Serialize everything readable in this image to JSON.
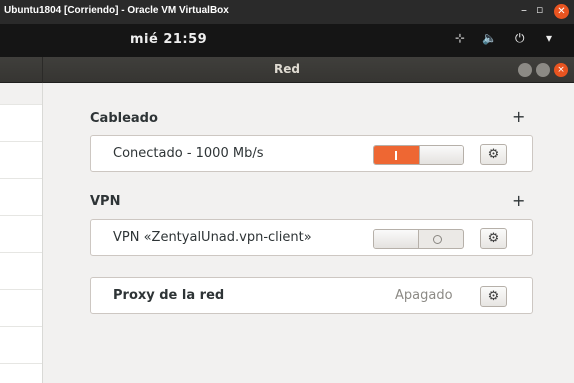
{
  "vbox": {
    "title": "Ubuntu1804 [Corriendo] - Oracle VM VirtualBox",
    "min": "–",
    "max": "▫",
    "close": "✕"
  },
  "topbar": {
    "clock": "mié 21:59",
    "network_icon": "network-wired-icon",
    "volume_icon": "volume-icon",
    "power_icon": "power-icon",
    "network_glyph": "⊹",
    "volume_glyph": "🔈",
    "power_glyph": "⏻",
    "menu_glyph": "▾"
  },
  "window": {
    "title": "Red",
    "close_glyph": "×"
  },
  "wired": {
    "section_title": "Cableado",
    "add_glyph": "+",
    "connection_label": "Conectado - 1000 Mb/s",
    "switch_on": true,
    "gear_glyph": "⚙"
  },
  "vpn": {
    "section_title": "VPN",
    "add_glyph": "+",
    "connection_label": "VPN «ZentyalUnad.vpn-client»",
    "switch_on": false,
    "gear_glyph": "⚙"
  },
  "proxy": {
    "label": "Proxy de la red",
    "status": "Apagado",
    "gear_glyph": "⚙"
  },
  "colors": {
    "accent": "#ee6733",
    "ubuntu_orange": "#e95420",
    "headerbar": "#3c3b37"
  }
}
